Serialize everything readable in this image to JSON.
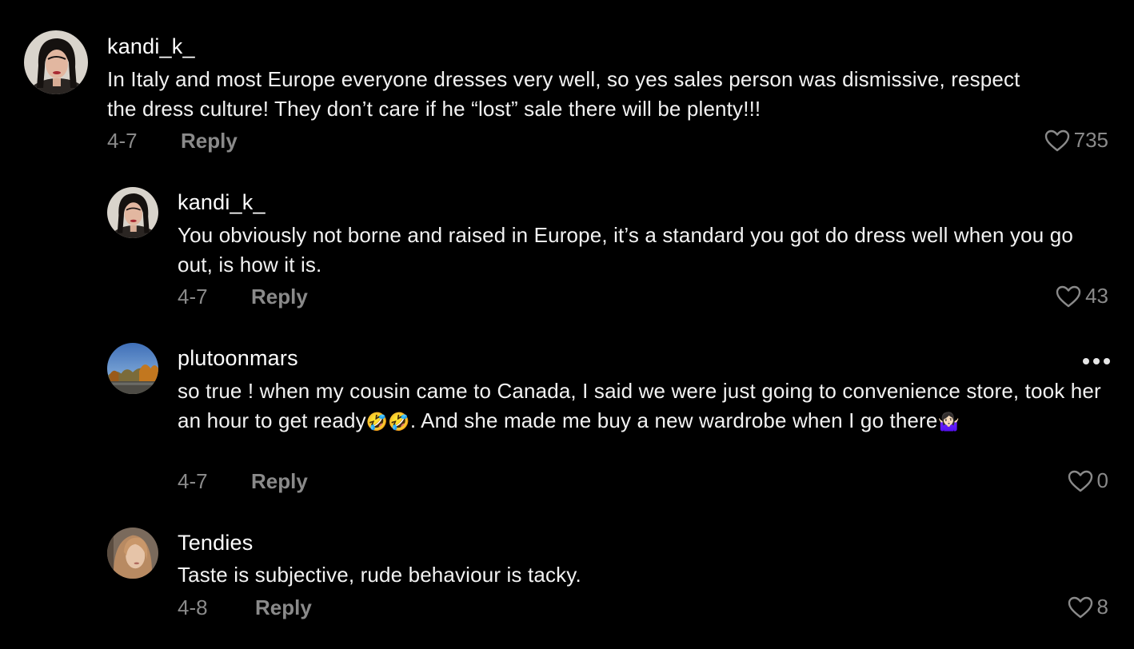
{
  "comments": [
    {
      "username": "kandi_k_",
      "text": "In Italy and most Europe everyone dresses very well, so yes sales person was dismissive, respect the dress culture! They don’t care if he “lost” sale there will be plenty!!!",
      "date": "4-7",
      "reply_label": "Reply",
      "likes": "735"
    },
    {
      "username": "kandi_k_",
      "text": "You obviously not borne and raised in Europe, it’s a standard you got do dress well when you go out, is how it is.",
      "date": "4-7",
      "reply_label": "Reply",
      "likes": "43"
    },
    {
      "username": "plutoonmars",
      "text_part1": "so true ! when my cousin came to Canada, I said we were just going to convenience store, took her an hour to get ready",
      "emoji_1": "🤣🤣",
      "text_part2": ". And she made me buy a new wardrobe when I go there",
      "emoji_2": "🤷🏻‍♀️",
      "date": "4-7",
      "reply_label": "Reply",
      "likes": "0",
      "more_icon": "more-horizontal-icon"
    },
    {
      "username": "Tendies",
      "text": "Taste is subjective, rude behaviour is tacky.",
      "date": "4-8",
      "reply_label": "Reply",
      "likes": "8"
    }
  ],
  "icons": {
    "like": "heart-outline-icon",
    "more": "ellipsis-icon"
  },
  "colors": {
    "background": "#000000",
    "primary_text": "#ffffff",
    "secondary_text": "#8a8a8a"
  }
}
